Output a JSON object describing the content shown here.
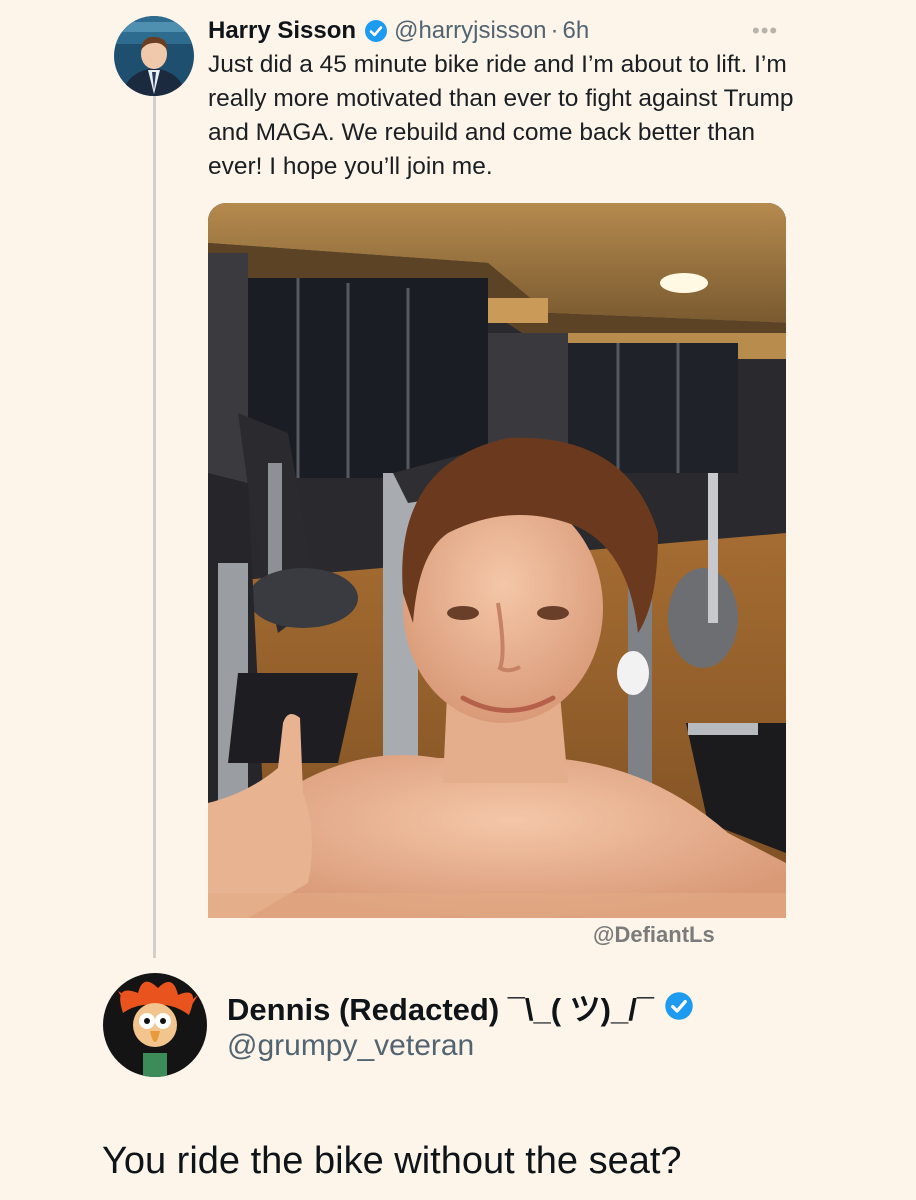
{
  "tweet": {
    "author_name": "Harry Sisson",
    "handle": "@harryjsisson",
    "separator": "·",
    "time": "6h",
    "more_icon": "more-dots-icon",
    "text": "Just did a 45 minute bike ride and I’m about to lift. I’m really more motivated than ever to fight against Trump and MAGA. We rebuild and come back better than ever! I hope you’ll join me.",
    "verified_color": "#1d9bf0"
  },
  "watermark": "@DefiantLs",
  "reply": {
    "author_name": "Dennis (Redacted) ¯\\_( ツ)_/¯",
    "handle": "@grumpy_veteran",
    "text": "You ride the bike without the seat?",
    "verified_color": "#1d9bf0"
  }
}
